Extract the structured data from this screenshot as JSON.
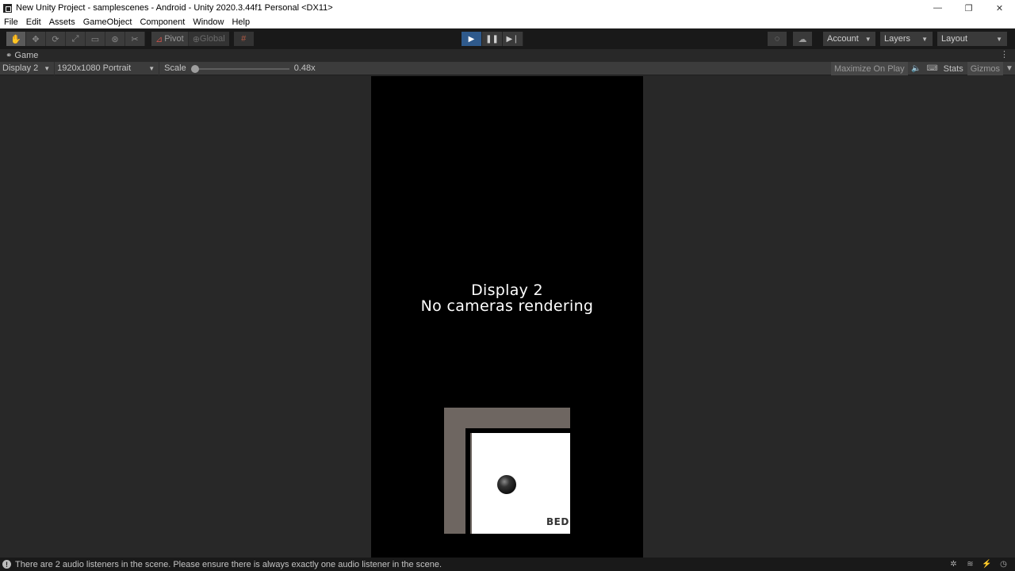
{
  "window": {
    "title": "New Unity Project - samplescenes - Android - Unity 2020.3.44f1 Personal <DX11>",
    "controls": {
      "minimize": "—",
      "restore": "❐",
      "close": "✕"
    }
  },
  "menu": [
    "File",
    "Edit",
    "Assets",
    "GameObject",
    "Component",
    "Window",
    "Help"
  ],
  "toolbar": {
    "tools": [
      {
        "name": "hand-tool",
        "glyph": "✋",
        "active": true
      },
      {
        "name": "move-tool",
        "glyph": "✥"
      },
      {
        "name": "rotate-tool",
        "glyph": "⟳"
      },
      {
        "name": "scale-tool",
        "glyph": "⤢"
      },
      {
        "name": "rect-tool",
        "glyph": "▭"
      },
      {
        "name": "transform-tool",
        "glyph": "⊛"
      },
      {
        "name": "custom-tool",
        "glyph": "✂"
      }
    ],
    "pivot_label": "Pivot",
    "global_label": "Global",
    "account_label": "Account",
    "layers_label": "Layers",
    "layout_label": "Layout"
  },
  "game_tab": {
    "label": "Game",
    "display": "Display 2",
    "resolution": "1920x1080 Portrait",
    "scale_label": "Scale",
    "scale_value": "0.48x",
    "scale_fraction": 0.0,
    "maximize_label": "Maximize On Play",
    "stats_label": "Stats",
    "gizmos_label": "Gizmos"
  },
  "game_view": {
    "line1": "Display 2",
    "line2": "No cameras rendering",
    "scene_text": "BED"
  },
  "status": {
    "message": "There are 2 audio listeners in the scene. Please ensure there is always exactly one audio listener in the scene."
  },
  "colors": {
    "play_active": "#2f5a8c",
    "editor_bg": "#282828",
    "toolbar_bg": "#191919"
  }
}
